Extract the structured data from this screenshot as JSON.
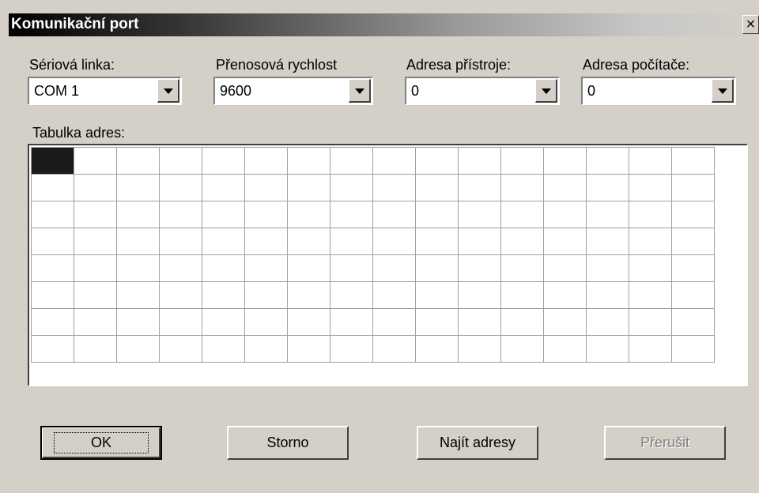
{
  "window": {
    "title": "Komunikační port",
    "close_label": "×"
  },
  "fields": [
    {
      "label": "Sériová linka:",
      "value": "COM 1"
    },
    {
      "label": "Přenosová rychlost",
      "value": "9600"
    },
    {
      "label": "Adresa přístroje:",
      "value": "0"
    },
    {
      "label": "Adresa počítače:",
      "value": "0"
    }
  ],
  "table": {
    "label": "Tabulka adres:",
    "rows": 8,
    "cols": 16,
    "selected_cell": [
      0,
      0
    ]
  },
  "buttons": {
    "ok": "OK",
    "storno": "Storno",
    "find": "Najít adresy",
    "interrupt": "Přerušit"
  },
  "icons": {
    "close": "close-icon",
    "dropdown": "chevron-down-icon"
  }
}
